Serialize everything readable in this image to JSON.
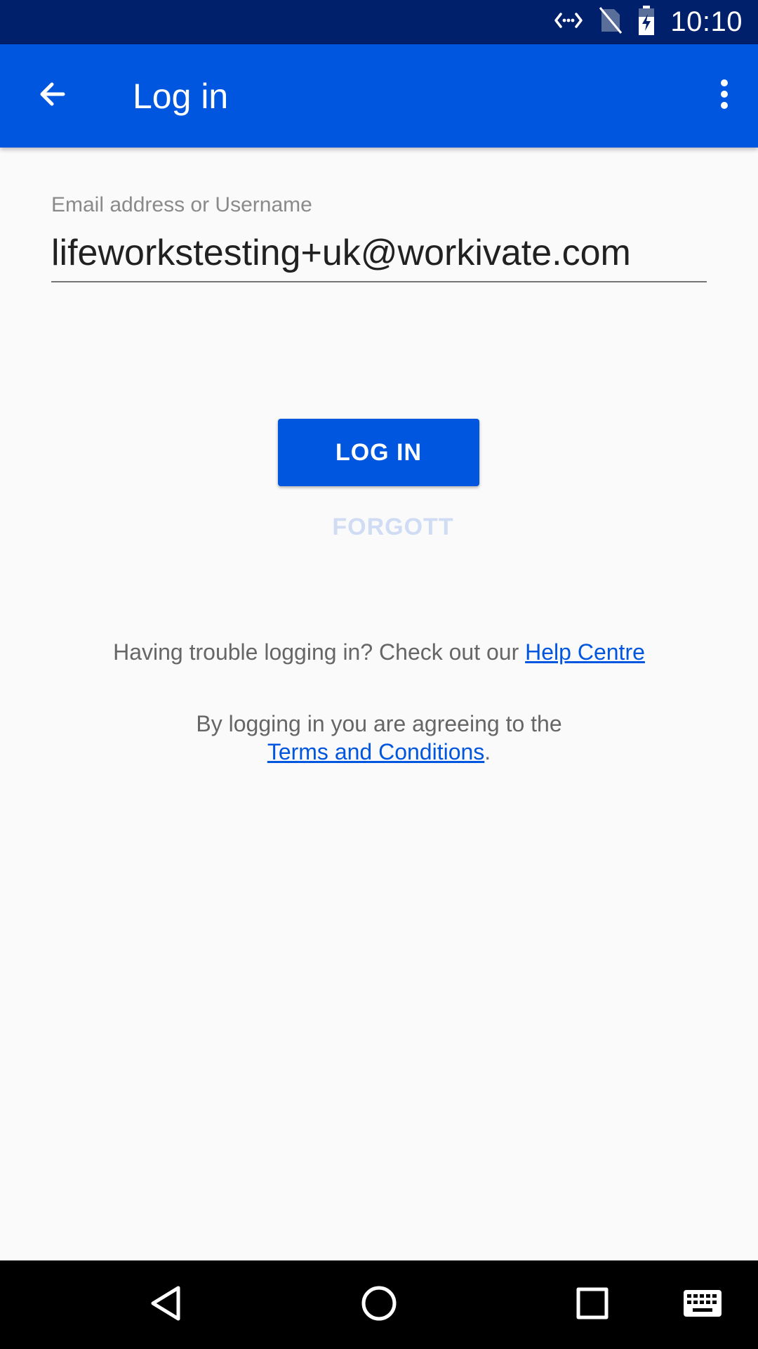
{
  "status_bar": {
    "time": "10:10",
    "icons": [
      "data-sync-icon",
      "no-sim-icon",
      "battery-charging-icon"
    ]
  },
  "app_bar": {
    "title": "Log in",
    "back_icon": "arrow-back-icon",
    "menu_icon": "more-vert-icon"
  },
  "form": {
    "email_label": "Email address or Username",
    "email_value": "lifeworkstesting+uk@workivate.com",
    "login_button": "LOG IN",
    "forgot_button": "FORGOTT"
  },
  "help": {
    "text": "Having trouble logging in? Check out our ",
    "link": "Help Centre"
  },
  "terms": {
    "text": "By logging in you are agreeing to the",
    "link": "Terms and Conditions",
    "suffix": "."
  },
  "nav_bar": {
    "icons": [
      "back-triangle-icon",
      "home-circle-icon",
      "recents-square-icon",
      "keyboard-icon"
    ]
  },
  "colors": {
    "status_bar": "#00206b",
    "primary": "#0156e0",
    "background": "#fafafa",
    "forgot_text": "#cfdcf3"
  }
}
